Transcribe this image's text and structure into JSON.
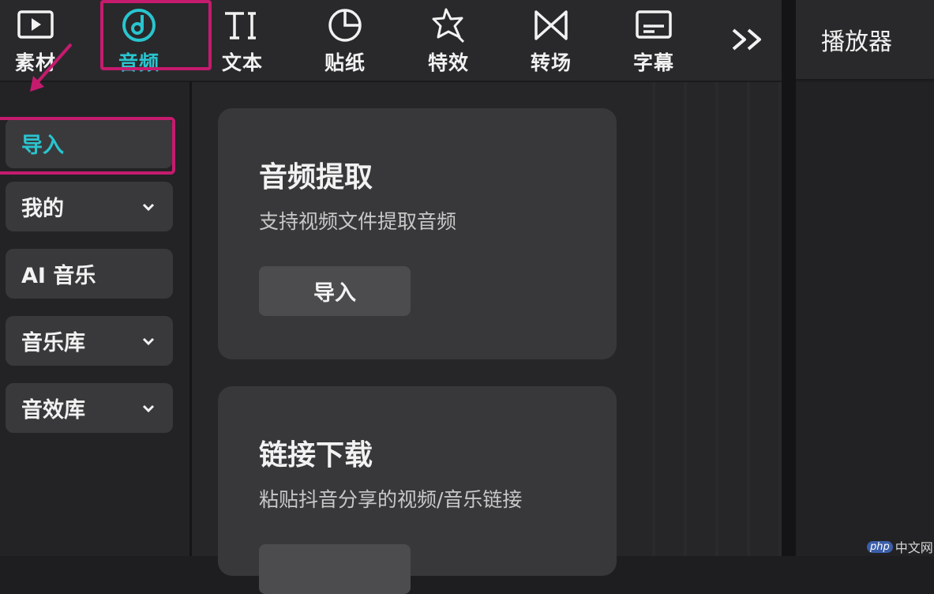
{
  "toolbar": {
    "items": [
      {
        "label": "素材",
        "icon": "media-play-icon"
      },
      {
        "label": "音频",
        "icon": "audio-note-icon",
        "active": true
      },
      {
        "label": "文本",
        "icon": "text-ti-icon"
      },
      {
        "label": "贴纸",
        "icon": "sticker-icon"
      },
      {
        "label": "特效",
        "icon": "effects-star-icon"
      },
      {
        "label": "转场",
        "icon": "transition-icon"
      },
      {
        "label": "字幕",
        "icon": "subtitle-icon"
      }
    ],
    "more_icon": "double-chevron-right-icon"
  },
  "player": {
    "title": "播放器"
  },
  "sidebar": {
    "items": [
      {
        "label": "导入",
        "active": true,
        "has_dropdown": false
      },
      {
        "label": "我的",
        "has_dropdown": true
      },
      {
        "label": "AI 音乐",
        "has_dropdown": false
      },
      {
        "label": "音乐库",
        "has_dropdown": true
      },
      {
        "label": "音效库",
        "has_dropdown": true
      }
    ]
  },
  "cards": [
    {
      "title": "音频提取",
      "desc": "支持视频文件提取音频",
      "button": "导入"
    },
    {
      "title": "链接下载",
      "desc": "粘贴抖音分享的视频/音乐链接",
      "button": ""
    }
  ],
  "colors": {
    "accent": "#29c5cf",
    "highlight": "#c51b6e",
    "panel": "#38383a"
  },
  "watermark": {
    "badge": "php",
    "text": "中文网"
  }
}
